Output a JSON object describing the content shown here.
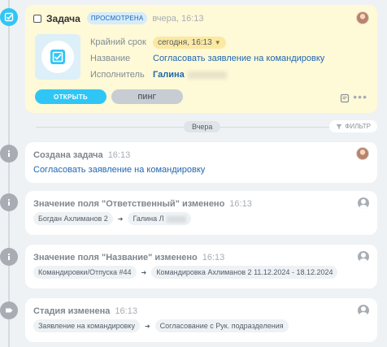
{
  "task": {
    "title": "Задача",
    "badge": "просмотрена",
    "time": "вчера, 16:13",
    "fields": [
      {
        "label": "Крайний срок",
        "value": "сегодня, 16:13"
      },
      {
        "label": "Название",
        "value": "Согласовать заявление на командировку"
      },
      {
        "label": "Исполнитель",
        "value": "Галина"
      }
    ],
    "open_label": "открыть",
    "ping_label": "пинг"
  },
  "divider": {
    "day": "Вчера",
    "filter_label": "фильтр"
  },
  "events": [
    {
      "title": "Создана задача",
      "time": "16:13",
      "link": "Согласовать заявление на командировку"
    },
    {
      "title": "Значение поля \"Ответственный\" изменено",
      "time": "16:13",
      "from": "Богдан Ахлиманов 2",
      "to": "Галина Л"
    },
    {
      "title": "Значение поля \"Название\" изменено",
      "time": "16:13",
      "from": "Командировки/Отпуска #44",
      "to": "Командировка Ахлиманов 2 11.12.2024 - 18.12.2024"
    },
    {
      "title": "Стадия изменена",
      "time": "16:13",
      "from": "Заявление на командировку",
      "to": "Согласование с Рук. подразделения"
    }
  ]
}
